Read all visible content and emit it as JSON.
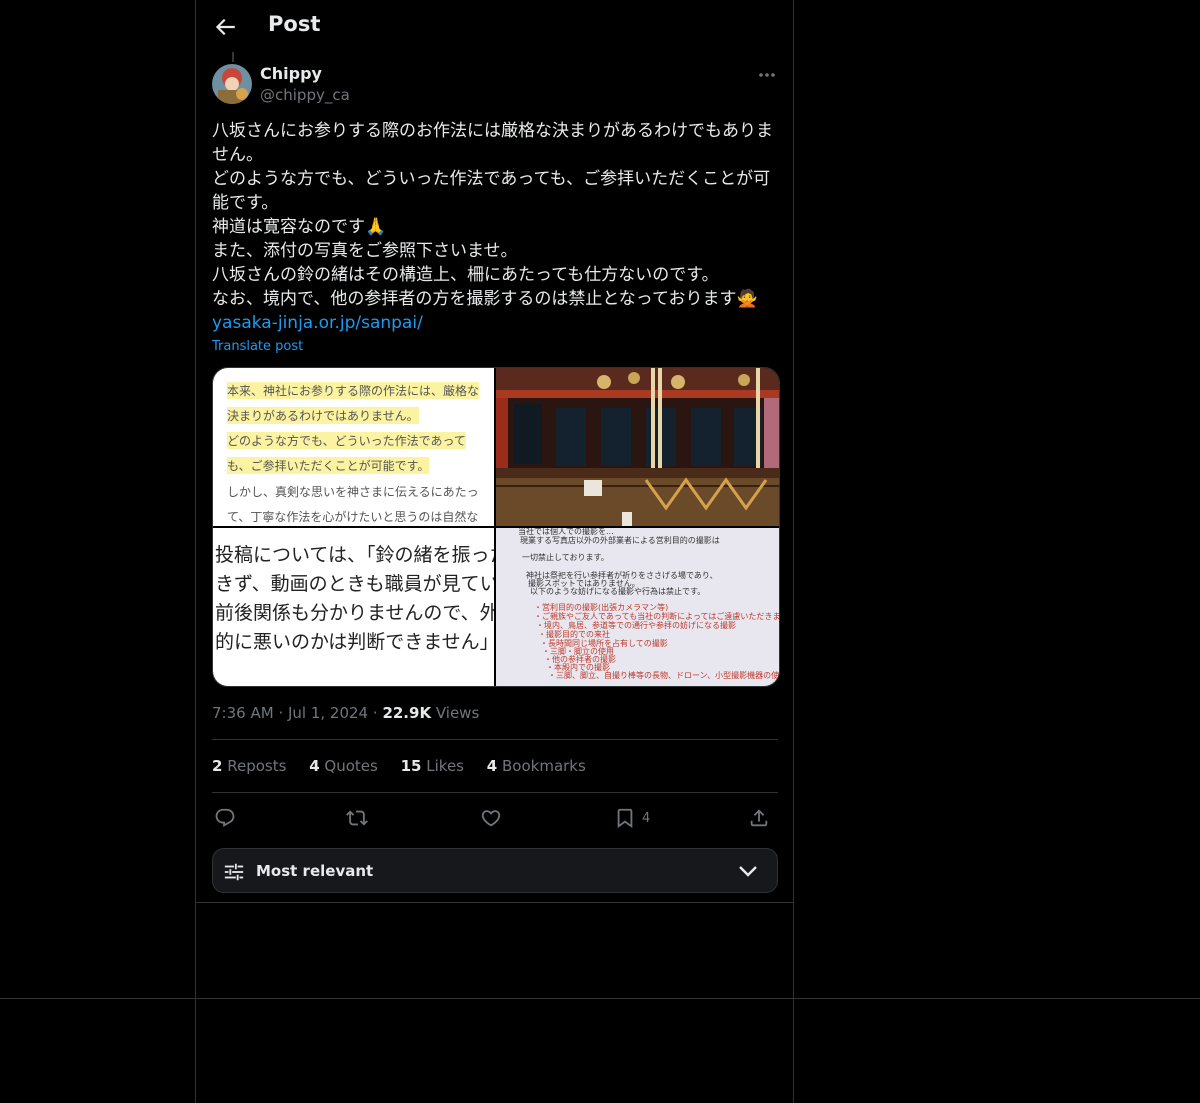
{
  "header": {
    "title": "Post"
  },
  "author": {
    "name": "Chippy",
    "handle": "@chippy_ca"
  },
  "post": {
    "lines": [
      "八坂さんにお参りする際のお作法には厳格な決まりがあるわけでもありま",
      "せん。",
      "どのような方でも、どういった作法であっても、ご参拝いただくことが可",
      "能です。",
      "神道は寛容なのです🙏",
      "また、添付の写真をご参照下さいませ。",
      "八坂さんの鈴の緒はその構造上、柵にあたっても仕方ないのです。",
      "なお、境内で、他の参拝者の方を撮影するのは禁止となっております🙅"
    ],
    "link": "yasaka-jinja.or.jp/sanpai/",
    "translate": "Translate post"
  },
  "media": {
    "image1_lines": [
      "本来、神社にお参りする際の作法には、厳格な",
      "決まりがあるわけではありません。",
      "どのような方でも、どういった作法であって",
      "も、ご参拝いただくことが可能です。",
      "しかし、真剣な思いを神さまに伝えるにあたっ",
      "て、丁寧な作法を心がけたいと思うのは自然な"
    ],
    "image3_lines": [
      "投稿については、「鈴の緒を振った場",
      "きず、動画のときも職員が見ていませ",
      "前後関係も分かりませんので、外国人",
      "的に悪いのかは判断できません」と話"
    ],
    "image4_lines": [
      "当社では個人での撮影を...",
      "現業する写真店以外の外部業者による営利目的の撮影は",
      "一切禁止しております。",
      "神社は祭祀を行い参拝者が祈りをささげる場であり、",
      "撮影スポットではありません。",
      "以下のような妨げになる撮影や行為は禁止です。",
      "・営利目的の撮影(出張カメラマン等)",
      "・ご親族やご友人であっても当社の判断によってはご遠慮いただきます",
      "・境内、鳥居、参道等での通行や参拝の妨げになる撮影",
      "・撮影目的での来社",
      "・長時間同じ場所を占有しての撮影",
      "・三脚・脚立の使用",
      "・他の参拝者の撮影",
      "・本殿内での撮影",
      "・三脚、脚立、自撮り棒等の長物、ドローン、小型撮影機器の使用"
    ]
  },
  "meta": {
    "time": "7:36 AM",
    "date": "Jul 1, 2024",
    "views_count": "22.9K",
    "views_label": "Views"
  },
  "stats": {
    "reposts": {
      "count": "2",
      "label": "Reposts"
    },
    "quotes": {
      "count": "4",
      "label": "Quotes"
    },
    "likes": {
      "count": "15",
      "label": "Likes"
    },
    "bookmarks": {
      "count": "4",
      "label": "Bookmarks"
    }
  },
  "actions": {
    "bookmark_count": "4"
  },
  "sort": {
    "label": "Most relevant"
  },
  "colors": {
    "accent": "#1d9bf0",
    "secondary_text": "#71767b",
    "border": "#2f3336"
  }
}
